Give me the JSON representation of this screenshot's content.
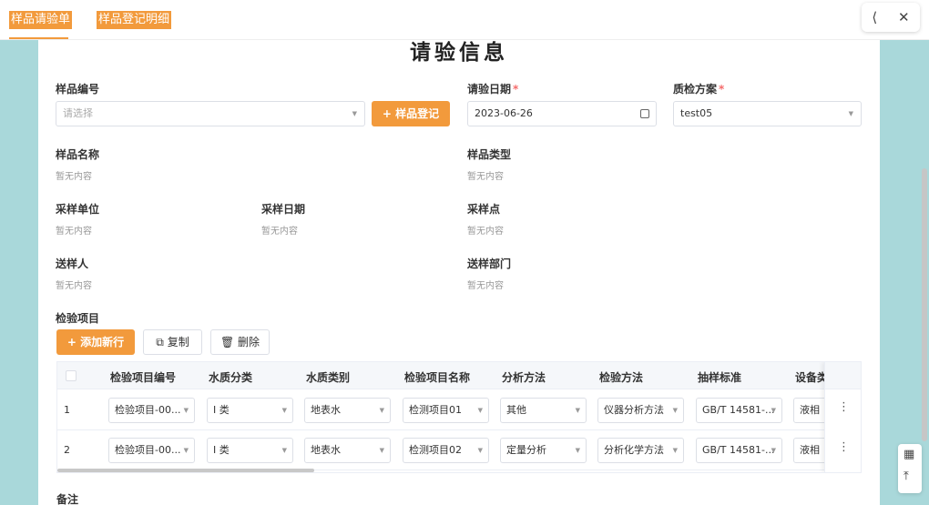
{
  "tabs": [
    {
      "label": "样品请验单",
      "active": true
    },
    {
      "label": "样品登记明细",
      "active": false
    }
  ],
  "top_actions": {
    "share_icon": "share-icon",
    "close_icon": "close-icon"
  },
  "heading": "请验信息",
  "form": {
    "sample_no": {
      "label": "样品编号",
      "placeholder": "请选择"
    },
    "register_button": "+ 样品登记",
    "request_date": {
      "label": "请验日期",
      "required_mark": "*",
      "value": "2023-06-26"
    },
    "qc_plan": {
      "label": "质检方案",
      "required_mark": "*",
      "value": "test05"
    },
    "sample_name": {
      "label": "样品名称",
      "value": "暂无内容"
    },
    "sample_type": {
      "label": "样品类型",
      "value": "暂无内容"
    },
    "sampling_unit": {
      "label": "采样单位",
      "value": "暂无内容"
    },
    "sampling_date": {
      "label": "采样日期",
      "value": "暂无内容"
    },
    "sampling_point": {
      "label": "采样点",
      "value": "暂无内容"
    },
    "sender": {
      "label": "送样人",
      "value": "暂无内容"
    },
    "send_dept": {
      "label": "送样部门",
      "value": "暂无内容"
    }
  },
  "items_section": {
    "label": "检验项目",
    "add_button": "+ 添加新行",
    "copy_button": "复制",
    "delete_button": "删除"
  },
  "table": {
    "headers": [
      "检验项目编号",
      "水质分类",
      "水质类别",
      "检验项目名称",
      "分析方法",
      "检验方法",
      "抽样标准",
      "设备类"
    ],
    "rows": [
      {
        "index": "1",
        "cells": [
          "检验项目-00...",
          "I 类",
          "地表水",
          "检测项目01",
          "其他",
          "仪器分析方法",
          "GB/T 14581-...",
          "液相"
        ]
      },
      {
        "index": "2",
        "cells": [
          "检验项目-00...",
          "I 类",
          "地表水",
          "检测项目02",
          "定量分析",
          "分析化学方法",
          "GB/T 14581-...",
          "液相"
        ]
      }
    ]
  },
  "remark_label": "备注",
  "colors": {
    "accent": "#f29a3c",
    "required": "#f56c6c",
    "background": "#a9d8da"
  }
}
